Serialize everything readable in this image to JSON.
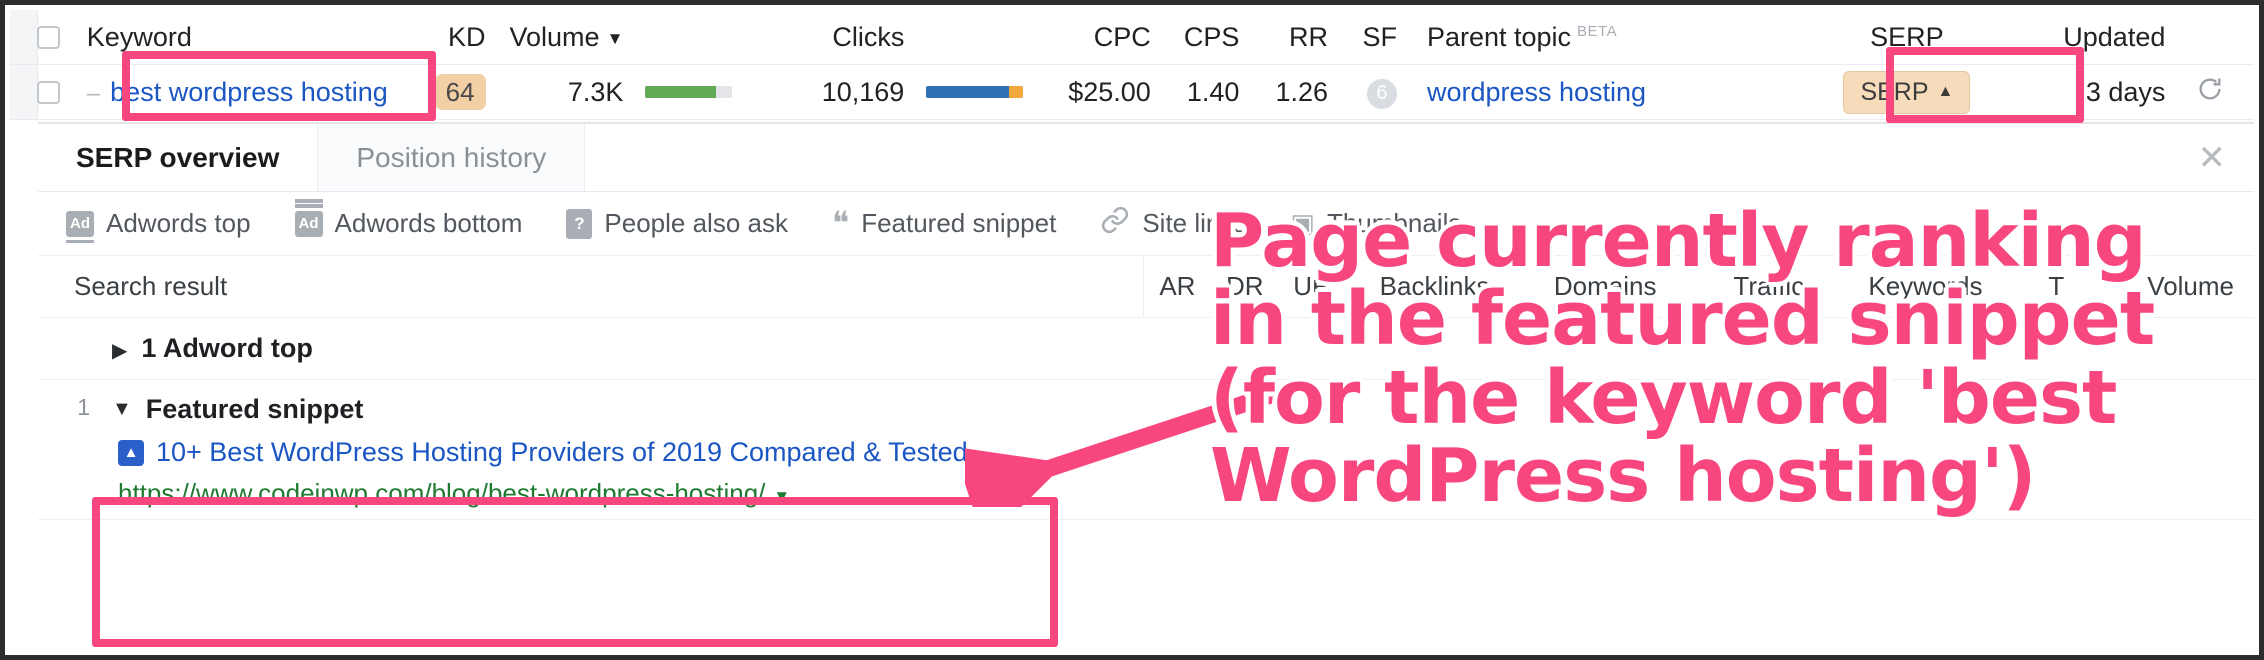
{
  "keyword_table": {
    "headers": {
      "keyword": "Keyword",
      "kd": "KD",
      "volume": "Volume",
      "clicks": "Clicks",
      "cpc": "CPC",
      "cps": "CPS",
      "rr": "RR",
      "sf": "SF",
      "parent_topic": "Parent topic",
      "parent_topic_badge": "BETA",
      "serp": "SERP",
      "updated": "Updated"
    },
    "row": {
      "keyword": "best wordpress hosting",
      "kd": "64",
      "volume": "7.3K",
      "clicks": "10,169",
      "cpc": "$25.00",
      "cps": "1.40",
      "rr": "1.26",
      "sf": "6",
      "parent_topic": "wordpress hosting",
      "serp_button": "SERP",
      "serp_caret": "▲",
      "updated": "3 days",
      "volume_bar_pct": 82,
      "clicks_blue_pct": 86,
      "clicks_orange_pct": 14
    }
  },
  "serp_panel": {
    "tabs": [
      {
        "label": "SERP overview",
        "active": true
      },
      {
        "label": "Position history",
        "active": false
      }
    ],
    "close_label": "✕",
    "features": [
      {
        "label": "Adwords top",
        "icon": "ad-top-icon",
        "glyph": "Ad"
      },
      {
        "label": "Adwords bottom",
        "icon": "ad-bottom-icon",
        "glyph": "Ad"
      },
      {
        "label": "People also ask",
        "icon": "question-box-icon",
        "glyph": "?"
      },
      {
        "label": "Featured snippet",
        "icon": "quote-icon",
        "glyph": "❝"
      },
      {
        "label": "Site links",
        "icon": "link-chain-icon",
        "glyph": "🔗"
      },
      {
        "label": "Thumbnails",
        "icon": "thumbnails-icon",
        "glyph": "▣"
      }
    ],
    "table_headers": {
      "search_result": "Search result",
      "ar": "AR",
      "dr": "DR",
      "ur": "UR",
      "backlinks": "Backlinks",
      "domains": "Domains",
      "traffic": "Traffic",
      "keywords": "Keywords",
      "top_keyword": "T",
      "volume": "Volume"
    },
    "rows": [
      {
        "type": "adword-top",
        "index": "",
        "caret": "▶",
        "label": "1 Adword top"
      },
      {
        "type": "featured-snippet",
        "index": "1",
        "caret": "▼",
        "label": "Featured snippet",
        "result_title": "10+ Best WordPress Hosting Providers of 2019 Compared & Tested",
        "result_url": "https://www.codeinwp.com/blog/best-wordpress-hosting/",
        "result_url_caret": "▼"
      }
    ]
  },
  "annotation": {
    "callout_text": "Page currently ranking\nin the featured snippet\n(for the keyword 'best\nWordPress hosting')",
    "accent_color": "#f8477e"
  }
}
